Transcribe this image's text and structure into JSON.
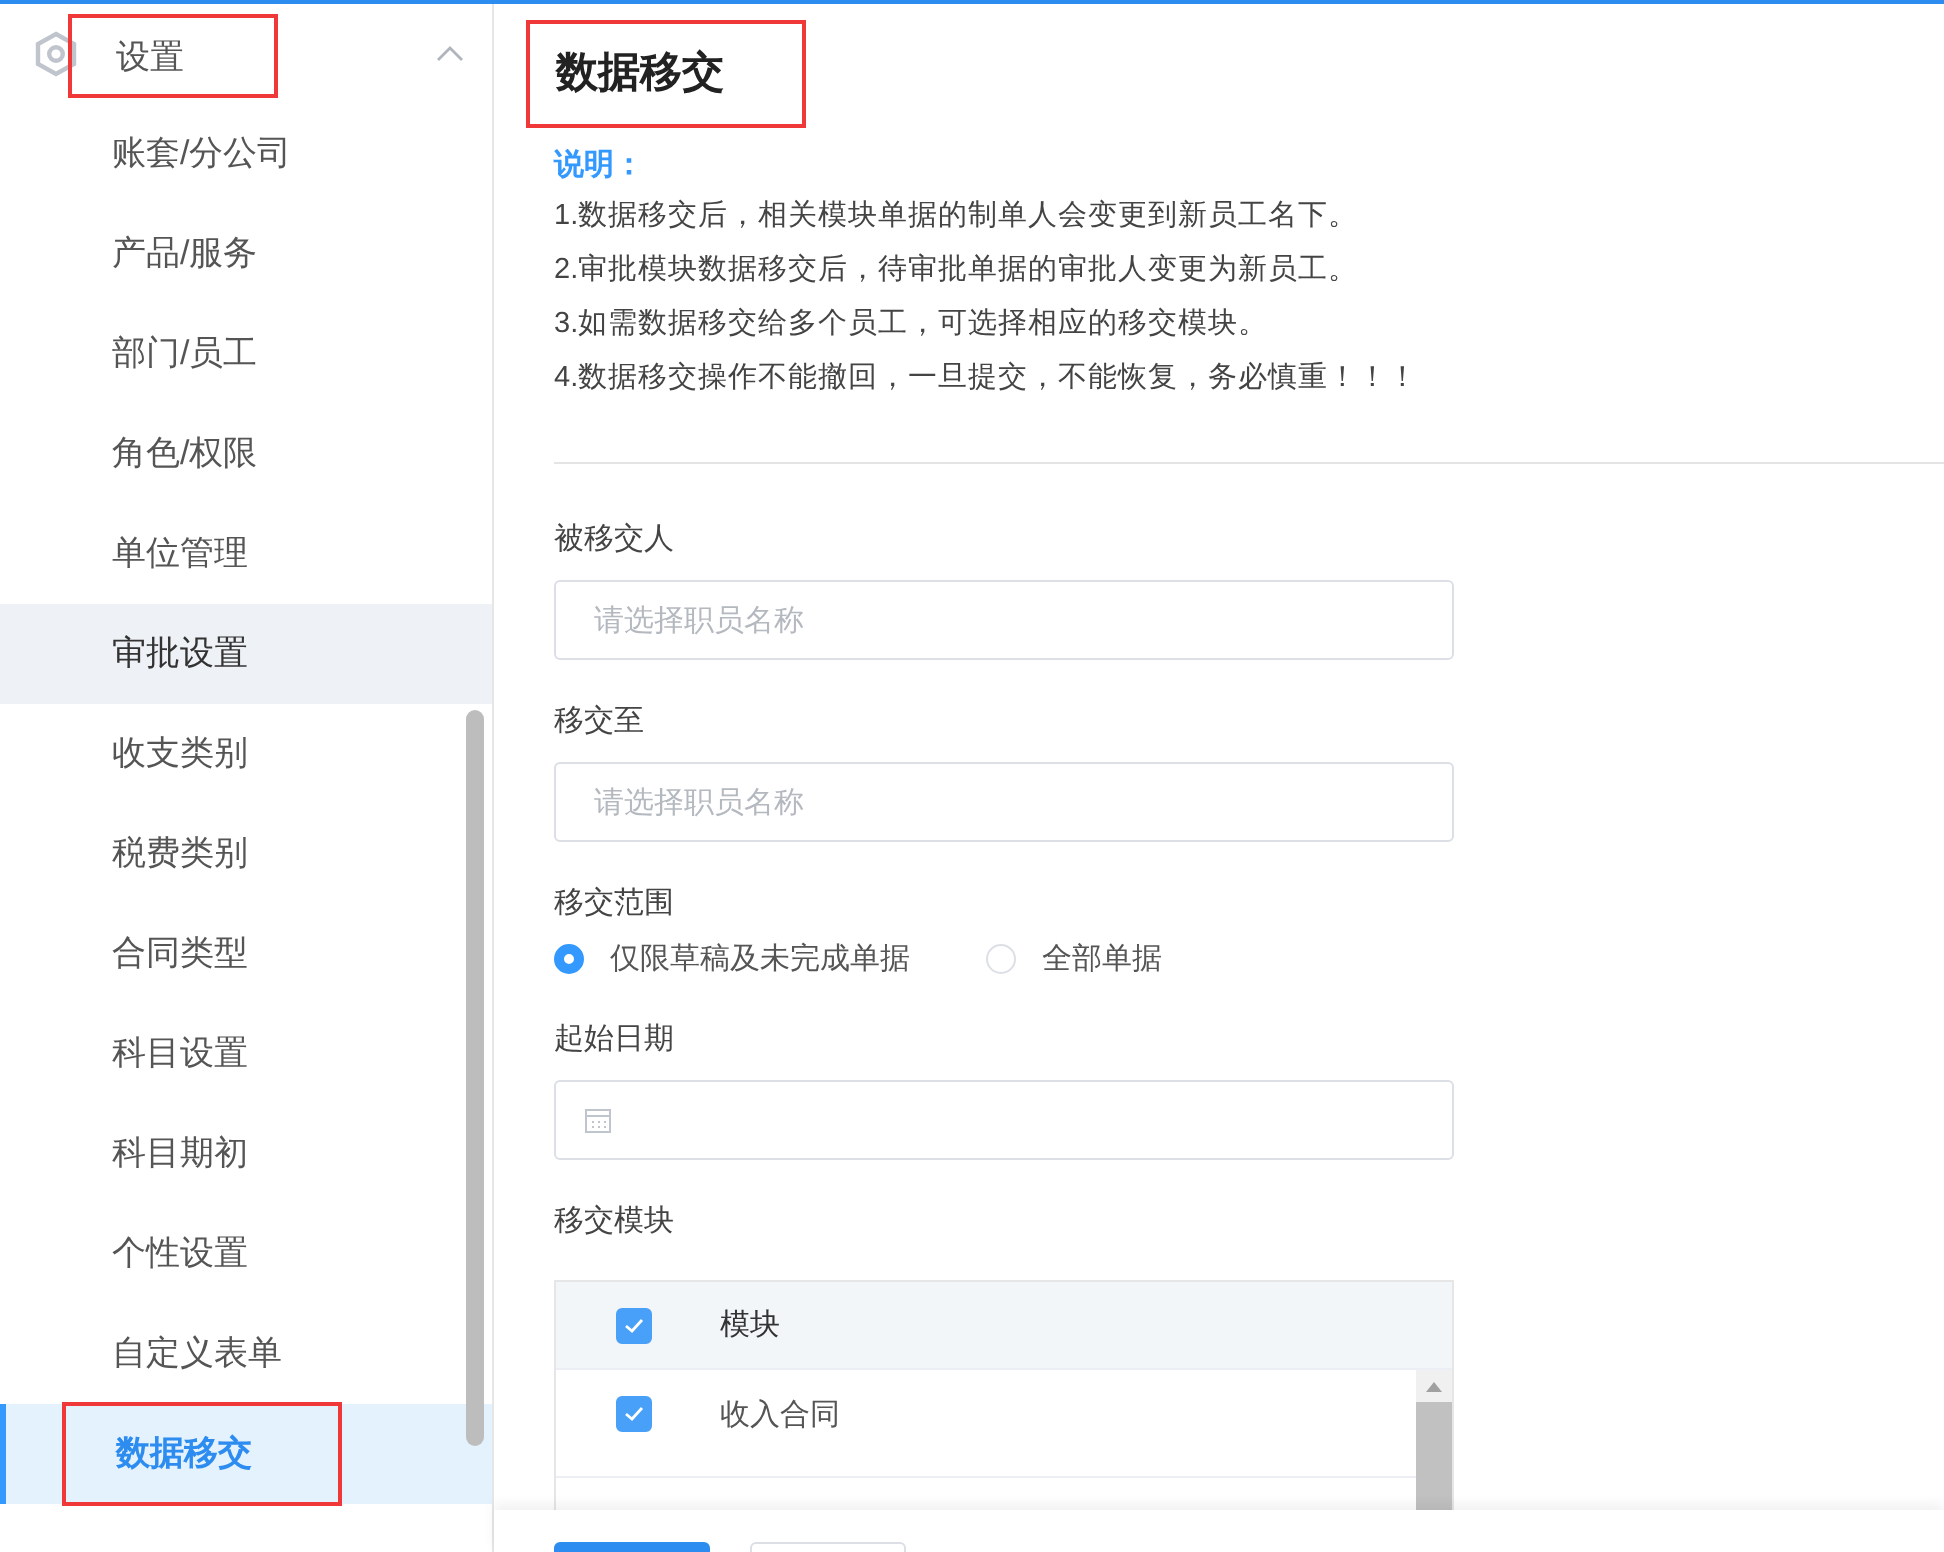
{
  "sidebar": {
    "header": {
      "label": "设置",
      "expanded": true,
      "annotated": true
    },
    "items": [
      {
        "label": "账套/分公司",
        "selected": false,
        "hovered": false,
        "annotated": false
      },
      {
        "label": "产品/服务",
        "selected": false,
        "hovered": false,
        "annotated": false
      },
      {
        "label": "部门/员工",
        "selected": false,
        "hovered": false,
        "annotated": false
      },
      {
        "label": "角色/权限",
        "selected": false,
        "hovered": false,
        "annotated": false
      },
      {
        "label": "单位管理",
        "selected": false,
        "hovered": false,
        "annotated": false
      },
      {
        "label": "审批设置",
        "selected": false,
        "hovered": true,
        "annotated": false
      },
      {
        "label": "收支类别",
        "selected": false,
        "hovered": false,
        "annotated": false
      },
      {
        "label": "税费类别",
        "selected": false,
        "hovered": false,
        "annotated": false
      },
      {
        "label": "合同类型",
        "selected": false,
        "hovered": false,
        "annotated": false
      },
      {
        "label": "科目设置",
        "selected": false,
        "hovered": false,
        "annotated": false
      },
      {
        "label": "科目期初",
        "selected": false,
        "hovered": false,
        "annotated": false
      },
      {
        "label": "个性设置",
        "selected": false,
        "hovered": false,
        "annotated": false
      },
      {
        "label": "自定义表单",
        "selected": false,
        "hovered": false,
        "annotated": false
      },
      {
        "label": "数据移交",
        "selected": true,
        "hovered": false,
        "annotated": true
      }
    ]
  },
  "page": {
    "title": "数据移交",
    "title_annotated": true,
    "notes": {
      "heading": "说明：",
      "lines": [
        "1.数据移交后，相关模块单据的制单人会变更到新员工名下。",
        "2.审批模块数据移交后，待审批单据的审批人变更为新员工。",
        "3.如需数据移交给多个员工，可选择相应的移交模块。",
        "4.数据移交操作不能撤回，一旦提交，不能恢复，务必慎重！！！"
      ]
    },
    "form": [
      {
        "kind": "select",
        "label": "被移交人",
        "placeholder": "请选择职员名称"
      },
      {
        "kind": "select",
        "label": "移交至",
        "placeholder": "请选择职员名称"
      },
      {
        "kind": "radio",
        "label": "移交范围",
        "options": [
          {
            "label": "仅限草稿及未完成单据",
            "selected": true
          },
          {
            "label": "全部单据",
            "selected": false
          }
        ]
      },
      {
        "kind": "date",
        "label": "起始日期"
      },
      {
        "kind": "table",
        "label": "移交模块",
        "header": {
          "label": "模块",
          "checked": true
        },
        "rows": [
          {
            "label": "收入合同",
            "checked": true
          }
        ]
      }
    ]
  },
  "footer_buttons": [
    {
      "kind": "primary"
    },
    {
      "kind": "default"
    }
  ]
}
